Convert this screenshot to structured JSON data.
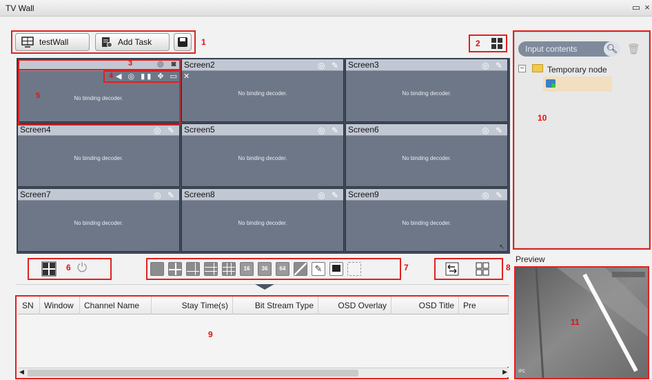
{
  "window": {
    "title": "TV Wall"
  },
  "toolbar": {
    "wall_label": "testWall",
    "add_task_label": "Add Task"
  },
  "annotations": [
    "1",
    "2",
    "3",
    "4",
    "5",
    "6",
    "7",
    "8",
    "9",
    "10",
    "11"
  ],
  "screens": [
    {
      "name": "",
      "message": "No binding decoder."
    },
    {
      "name": "Screen2",
      "message": "No binding decoder."
    },
    {
      "name": "Screen3",
      "message": "No binding decoder."
    },
    {
      "name": "Screen4",
      "message": "No binding decoder."
    },
    {
      "name": "Screen5",
      "message": "No binding decoder."
    },
    {
      "name": "Screen6",
      "message": "No binding decoder."
    },
    {
      "name": "Screen7",
      "message": "No binding decoder."
    },
    {
      "name": "Screen8",
      "message": "No binding decoder."
    },
    {
      "name": "Screen9",
      "message": "No binding decoder."
    }
  ],
  "layout_labels": [
    "16",
    "36",
    "64"
  ],
  "table": {
    "columns": [
      "SN",
      "Window",
      "Channel Name",
      "Stay Time(s)",
      "Bit Stream Type",
      "OSD Overlay",
      "OSD Title",
      "Pre"
    ]
  },
  "sidebar": {
    "search_placeholder": "Input contents",
    "tree": [
      {
        "label": "Temporary node"
      }
    ]
  },
  "preview": {
    "label": "Preview",
    "overlay_text": "IPC"
  },
  "colors": {
    "annotation": "#e02020",
    "screen_bg": "#6e7788",
    "header_bg": "#c2c8d3"
  }
}
